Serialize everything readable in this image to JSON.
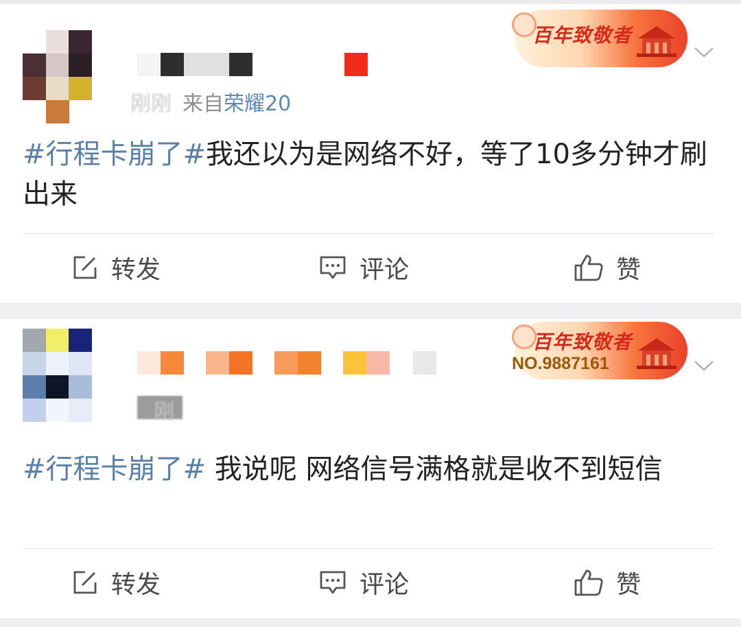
{
  "posts": [
    {
      "time": "刚刚",
      "source_prefix": "来自",
      "device": "荣耀20",
      "badge": {
        "title": "百年致敬者",
        "number": ""
      },
      "hashtag": "#行程卡崩了#",
      "content": "我还以为是网络不好，等了10多分钟才刷出来",
      "actions": {
        "repost": "转发",
        "comment": "评论",
        "like": "赞"
      }
    },
    {
      "time": "刚",
      "source_prefix": "",
      "device": "",
      "badge": {
        "title": "百年致敬者",
        "number": "NO.9887161"
      },
      "hashtag": "#行程卡崩了#",
      "content": " 我说呢 网络信号满格就是收不到短信",
      "actions": {
        "repost": "转发",
        "comment": "评论",
        "like": "赞"
      }
    }
  ],
  "colors": {
    "link": "#5b7fa6",
    "text": "#222222",
    "muted": "#8f8f8f",
    "badge_red": "#d42a1b",
    "page_bg": "#efeff1"
  },
  "icons": [
    "edit-icon",
    "comment-icon",
    "thumbs-up-icon",
    "chevron-down-icon"
  ]
}
